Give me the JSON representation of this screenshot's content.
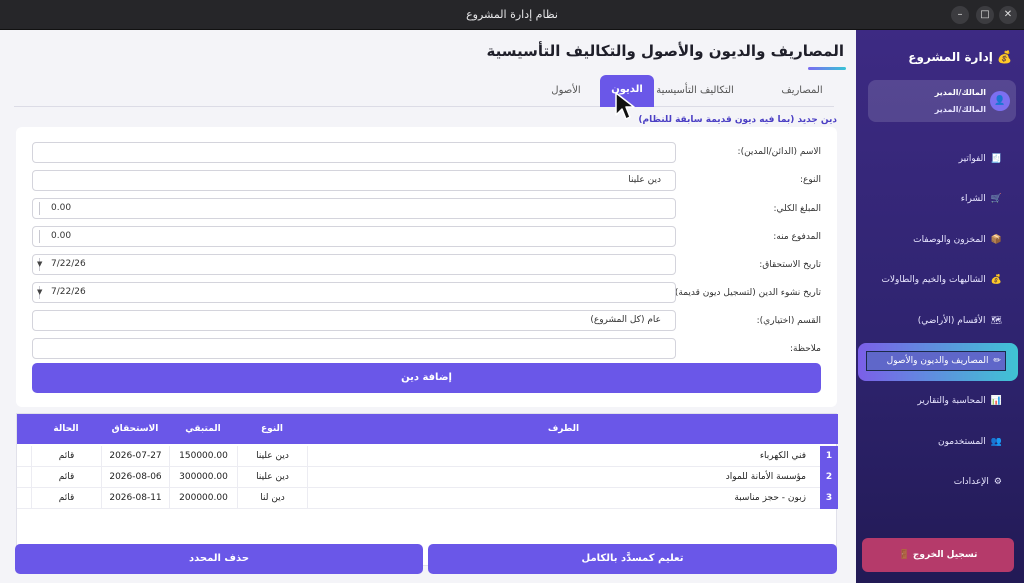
{
  "window": {
    "title": "نظام إدارة المشروع",
    "min_icon": "minimize-icon",
    "max_icon": "maximize-icon",
    "close_icon": "close-icon"
  },
  "page": {
    "title": "المصاريف والديون والأصول والتكاليف التأسيسية"
  },
  "tabs": [
    {
      "label": "المصاريف",
      "active": false
    },
    {
      "label": "التكاليف التأسيسية",
      "active": false
    },
    {
      "label": "الديون",
      "active": true
    },
    {
      "label": "الأصول",
      "active": false
    }
  ],
  "form": {
    "section_label": "دين جديد (بما فيه ديون قديمة سابقة للنظام)",
    "name_label": "الاسم (الدائن/المدين):",
    "name_value": "",
    "type_label": "النوع:",
    "type_value": "دين علينا",
    "total_label": "المبلغ الكلي:",
    "total_value": "0.00",
    "paid_label": "المدفوع منه:",
    "paid_value": "0.00",
    "due_label": "تاريخ الاستحقاق:",
    "due_value": "7/22/26",
    "origin_label": "تاريخ نشوء الدين (لتسجيل ديون قديمة):",
    "origin_value": "7/22/26",
    "dept_label": "القسم (اختياري):",
    "dept_value": "عام (كل المشروع)",
    "note_label": "ملاحظة:",
    "note_value": "",
    "add_button": "إضافة دين"
  },
  "table": {
    "headers": {
      "party": "الطرف",
      "type": "النوع",
      "remaining": "المتبقي",
      "due": "الاستحقاق",
      "status": "الحالة"
    },
    "rows": [
      {
        "num": "1",
        "party": "فني الكهرباء",
        "type": "دين علينا",
        "remaining": "150000.00",
        "due": "2026-07-27",
        "status": "قائم"
      },
      {
        "num": "2",
        "party": "مؤسسة الأمانة للمواد",
        "type": "دين علينا",
        "remaining": "300000.00",
        "due": "2026-08-06",
        "status": "قائم"
      },
      {
        "num": "3",
        "party": "زبون - حجز مناسبة",
        "type": "دين لنا",
        "remaining": "200000.00",
        "due": "2026-08-11",
        "status": "قائم"
      }
    ]
  },
  "actions": {
    "mark_paid": "تعليم كمسدَّد بالكامل",
    "delete_selected": "حذف المحدد"
  },
  "sidebar": {
    "brand": "إدارة المشروع",
    "brand_icon": "money-bag-icon",
    "user_name": "المالك/المدير",
    "user_role": "المالك/المدير",
    "items": [
      {
        "label": "الفواتير",
        "icon": "receipt-icon",
        "glyph": "🧾",
        "active": false
      },
      {
        "label": "الشراء",
        "icon": "cart-icon",
        "glyph": "🛒",
        "active": false
      },
      {
        "label": "المخزون والوصفات",
        "icon": "box-icon",
        "glyph": "📦",
        "active": false
      },
      {
        "label": "الشاليهات والخيم والطاولات",
        "icon": "money-bag-icon",
        "glyph": "💰",
        "active": false
      },
      {
        "label": "الأقسام (الأراضي)",
        "icon": "map-icon",
        "glyph": "🗺",
        "active": false
      },
      {
        "label": "المصاريف والديون والأصول",
        "icon": "pencil-icon",
        "glyph": "✏",
        "active": true
      },
      {
        "label": "المحاسبة والتقارير",
        "icon": "chart-icon",
        "glyph": "📊",
        "active": false
      },
      {
        "label": "المستخدمون",
        "icon": "users-icon",
        "glyph": "👥",
        "active": false
      },
      {
        "label": "الإعدادات",
        "icon": "gear-icon",
        "glyph": "⚙",
        "active": false
      }
    ],
    "logout": "تسجيل الخروج"
  }
}
